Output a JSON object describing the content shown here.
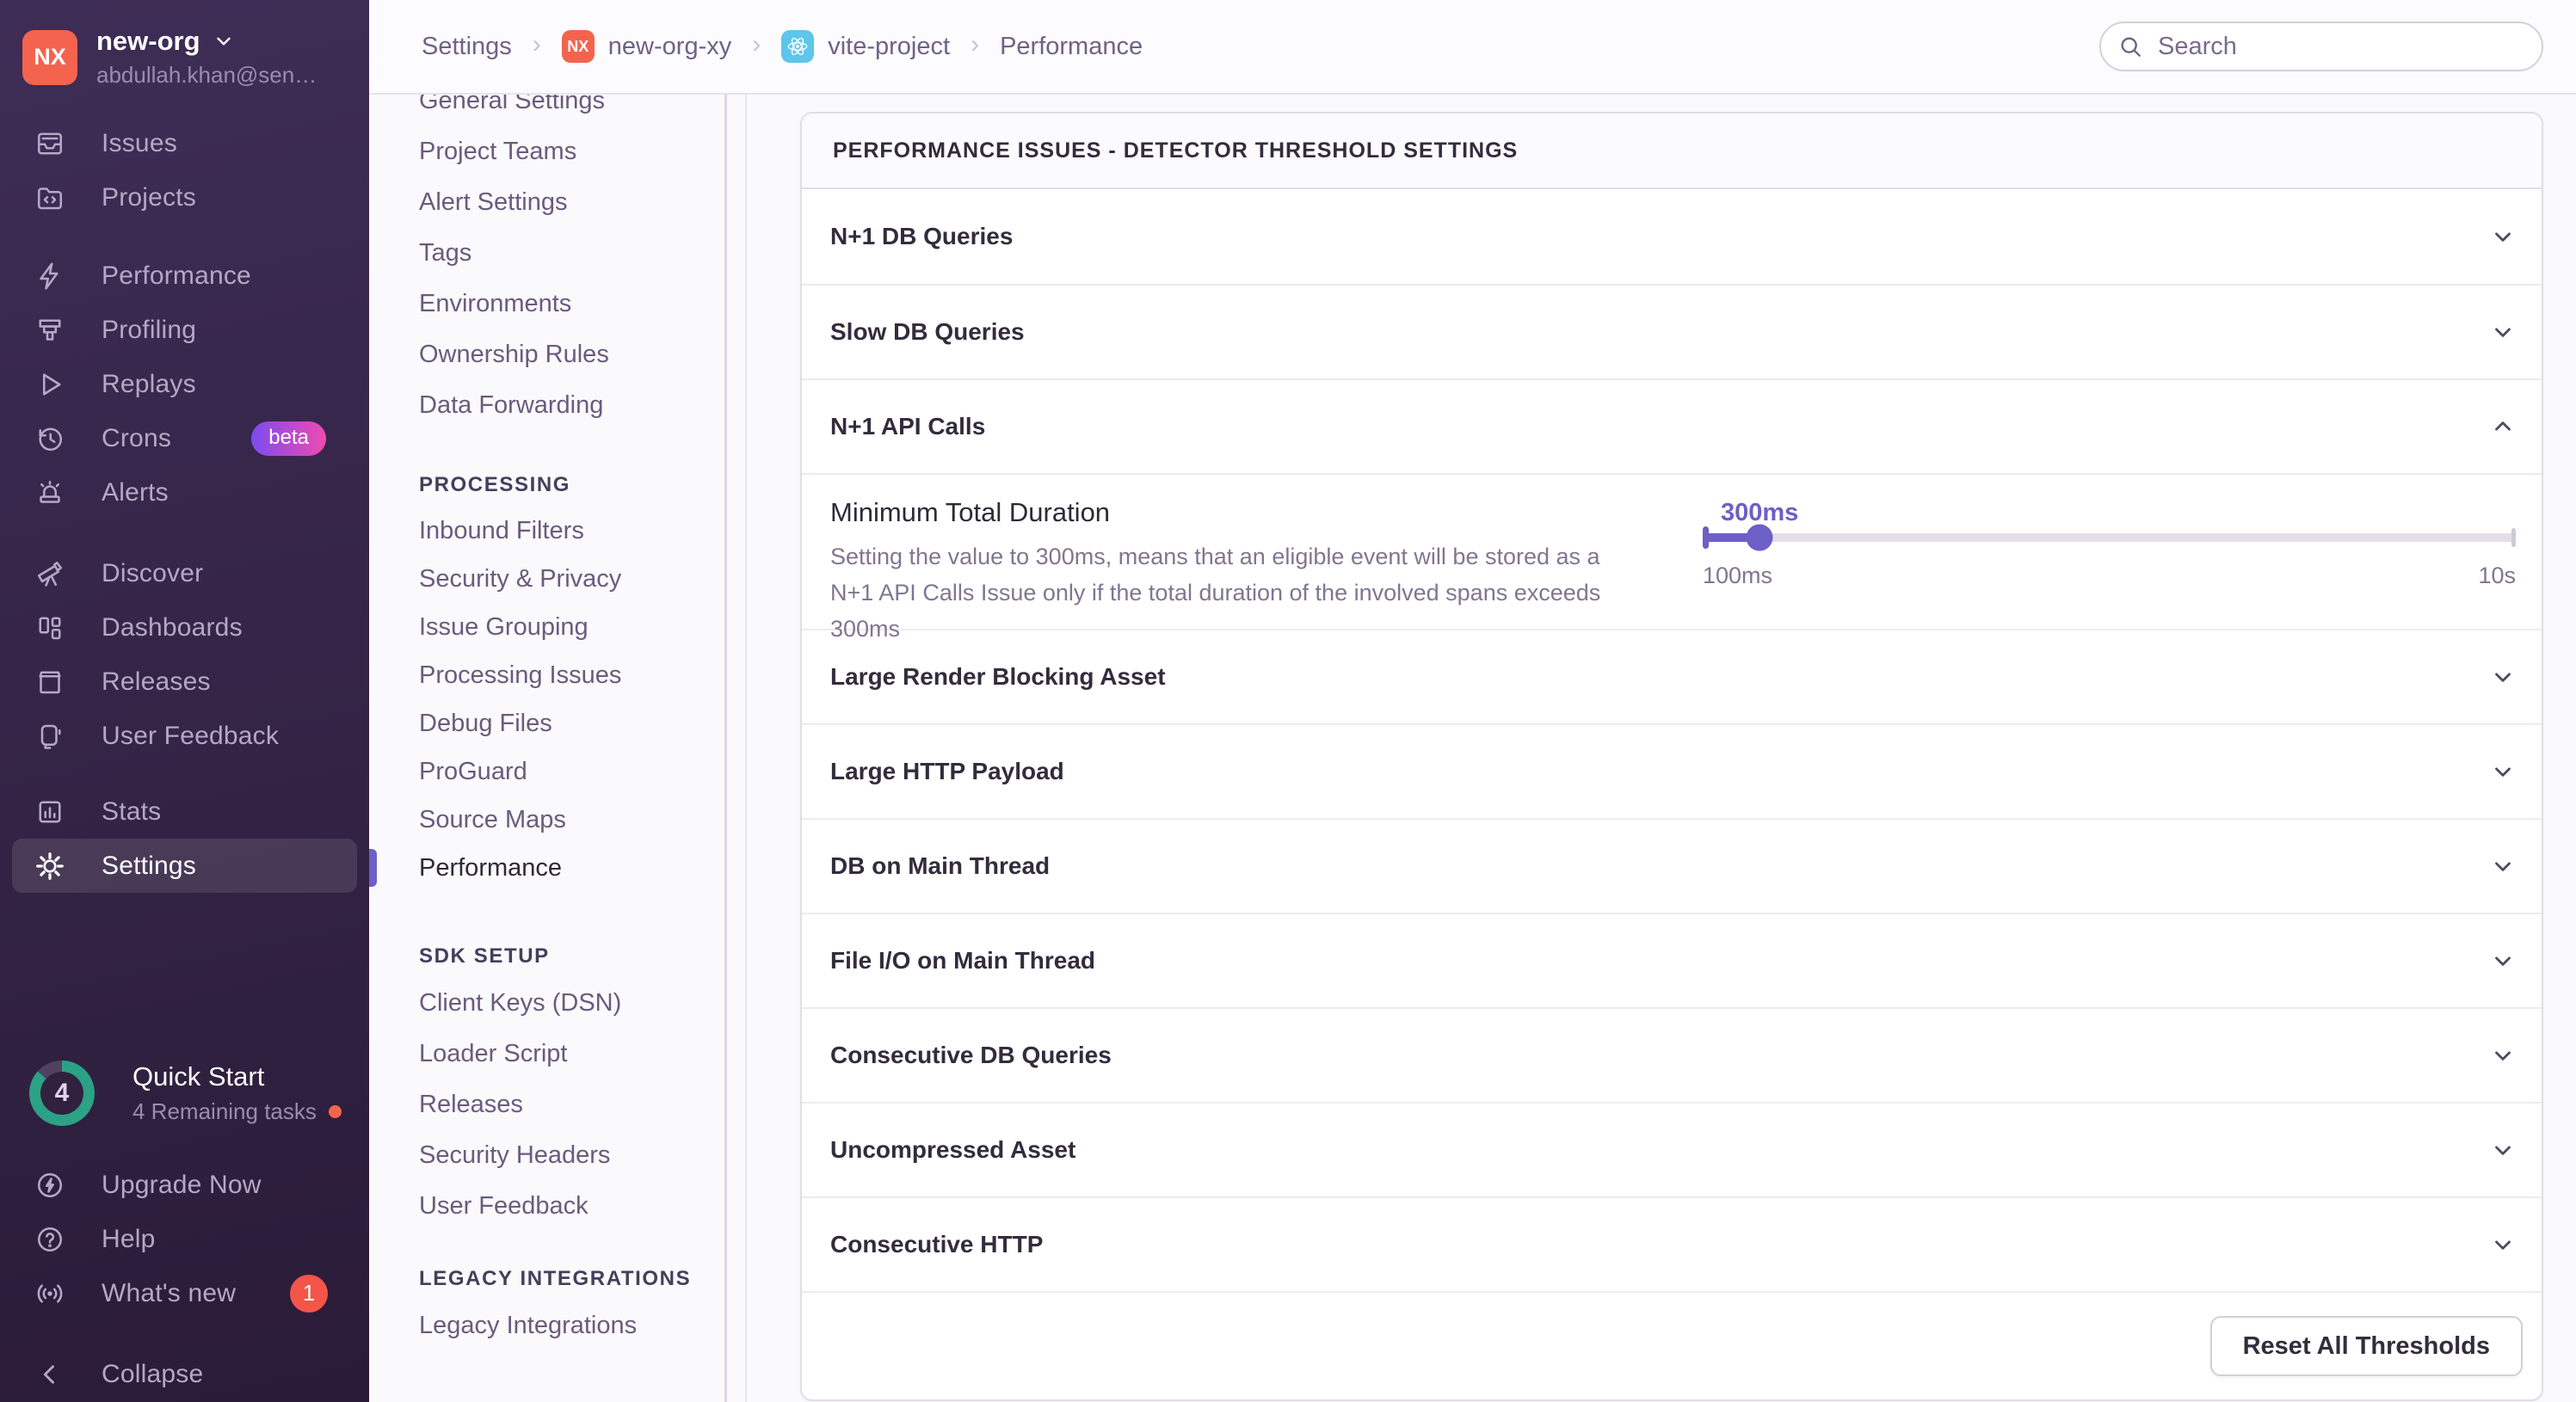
{
  "colors": {
    "accent_blurple": "#6c5fc7",
    "sidebar_top": "#3e2d56",
    "sidebar_bottom": "#2a1b38",
    "org_avatar_orange": "#f4634e",
    "react_badge_cyan": "#5ec6ea",
    "beta_gradient": [
      "#7c4bf0",
      "#ef4bb0"
    ],
    "notification_red": "#f45549",
    "progress_teal": "#2ba185"
  },
  "sidebar": {
    "org": {
      "initials": "NX",
      "name": "new-org",
      "email": "abdullah.khan@sen…"
    },
    "items": {
      "issues": "Issues",
      "projects": "Projects",
      "performance": "Performance",
      "profiling": "Profiling",
      "replays": "Replays",
      "crons": "Crons",
      "crons_badge": "beta",
      "alerts": "Alerts",
      "discover": "Discover",
      "dashboards": "Dashboards",
      "releases": "Releases",
      "user_feedback": "User Feedback",
      "stats": "Stats",
      "settings": "Settings"
    },
    "quick_start": {
      "count": "4",
      "title": "Quick Start",
      "subtitle": "4 Remaining tasks"
    },
    "footer": {
      "upgrade": "Upgrade Now",
      "help": "Help",
      "whats_new": "What's new",
      "whats_new_badge": "1",
      "collapse": "Collapse"
    }
  },
  "topbar": {
    "breadcrumbs": {
      "settings": "Settings",
      "org_initials": "NX",
      "org": "new-org-xy",
      "project": "vite-project",
      "page": "Performance"
    },
    "search_placeholder": "Search"
  },
  "settings_nav": {
    "general": [
      "General Settings",
      "Project Teams",
      "Alert Settings",
      "Tags",
      "Environments",
      "Ownership Rules",
      "Data Forwarding"
    ],
    "processing_title": "PROCESSING",
    "processing": [
      "Inbound Filters",
      "Security & Privacy",
      "Issue Grouping",
      "Processing Issues",
      "Debug Files",
      "ProGuard",
      "Source Maps"
    ],
    "active_item": "Performance",
    "sdk_title": "SDK SETUP",
    "sdk": [
      "Client Keys (DSN)",
      "Loader Script",
      "Releases",
      "Security Headers",
      "User Feedback"
    ],
    "legacy_title": "LEGACY INTEGRATIONS",
    "legacy": [
      "Legacy Integrations"
    ]
  },
  "panel": {
    "title": "PERFORMANCE ISSUES - DETECTOR THRESHOLD SETTINGS",
    "collapsed_before": [
      "N+1 DB Queries",
      "Slow DB Queries"
    ],
    "expanded_row": "N+1 API Calls",
    "setting": {
      "label": "Minimum Total Duration",
      "description": "Setting the value to 300ms, means that an eligible event will be stored as a N+1 API Calls Issue only if the total duration of the involved spans exceeds 300ms",
      "value_label": "300ms",
      "min_label": "100ms",
      "max_label": "10s",
      "value_percent": 7
    },
    "collapsed_after": [
      "Large Render Blocking Asset",
      "Large HTTP Payload",
      "DB on Main Thread",
      "File I/O on Main Thread",
      "Consecutive DB Queries",
      "Uncompressed Asset",
      "Consecutive HTTP"
    ],
    "reset_button": "Reset All Thresholds"
  }
}
